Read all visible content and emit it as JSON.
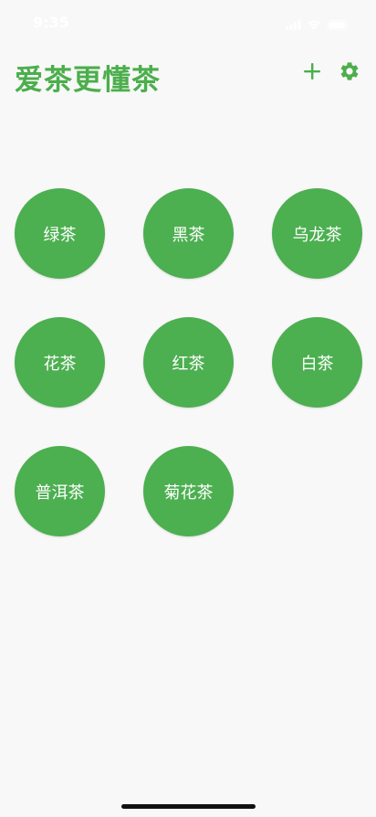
{
  "status_bar": {
    "time": "9:35"
  },
  "header": {
    "title": "爱茶更懂茶",
    "add_icon": "plus-icon",
    "settings_icon": "gear-icon"
  },
  "teas": [
    {
      "label": "绿茶"
    },
    {
      "label": "黑茶"
    },
    {
      "label": "乌龙茶"
    },
    {
      "label": "花茶"
    },
    {
      "label": "红茶"
    },
    {
      "label": "白茶"
    },
    {
      "label": "普洱茶"
    },
    {
      "label": "菊花茶"
    }
  ],
  "colors": {
    "accent": "#4caf50",
    "title": "#4cae4c",
    "background": "#f8f8f8"
  }
}
